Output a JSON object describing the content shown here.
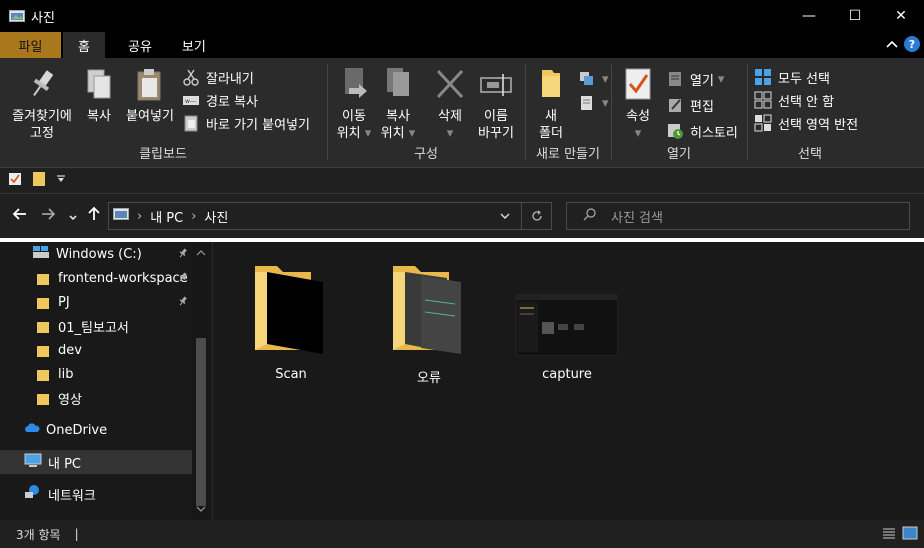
{
  "window": {
    "title": "사진"
  },
  "window_controls": {
    "minimize": "—",
    "maximize": "☐",
    "close": "✕"
  },
  "tabs": [
    {
      "label": "파일"
    },
    {
      "label": "홈"
    },
    {
      "label": "공유"
    },
    {
      "label": "보기"
    }
  ],
  "ribbon": {
    "clipboard": {
      "label": "클립보드",
      "pin_line1": "즐겨찾기에",
      "pin_line2": "고정",
      "copy": "복사",
      "paste": "붙여넣기",
      "cut": "잘라내기",
      "copy_path": "경로 복사",
      "paste_shortcut": "바로 가기 붙여넣기"
    },
    "organize": {
      "label": "구성",
      "move_line1": "이동",
      "move_line2": "위치",
      "copy_line1": "복사",
      "copy_line2": "위치",
      "delete": "삭제",
      "rename_line1": "이름",
      "rename_line2": "바꾸기"
    },
    "new": {
      "label": "새로 만들기",
      "folder_line1": "새",
      "folder_line2": "폴더"
    },
    "open": {
      "label": "열기",
      "properties": "속성",
      "open": "열기",
      "edit": "편집",
      "history": "히스토리"
    },
    "select": {
      "label": "선택",
      "select_all": "모두 선택",
      "select_none": "선택 안 함",
      "invert": "선택 영역 반전"
    }
  },
  "address": {
    "crumb1": "내 PC",
    "crumb2": "사진",
    "search_placeholder": "사진 검색"
  },
  "navpane": {
    "items": [
      {
        "label": "Windows (C:)"
      },
      {
        "label": "frontend-workspace"
      },
      {
        "label": "PJ"
      },
      {
        "label": "01_팀보고서"
      },
      {
        "label": "dev"
      },
      {
        "label": "lib"
      },
      {
        "label": "영상"
      },
      {
        "label": "OneDrive"
      },
      {
        "label": "내 PC"
      },
      {
        "label": "네트워크"
      }
    ]
  },
  "files": [
    {
      "name": "Scan"
    },
    {
      "name": "오류"
    },
    {
      "name": "capture"
    }
  ],
  "status": {
    "count": "3개 항목",
    "cursor": "|"
  },
  "colors": {
    "file_tab": "#a9781c",
    "folder": "#f0c75e",
    "accent": "#2a7ad6"
  }
}
